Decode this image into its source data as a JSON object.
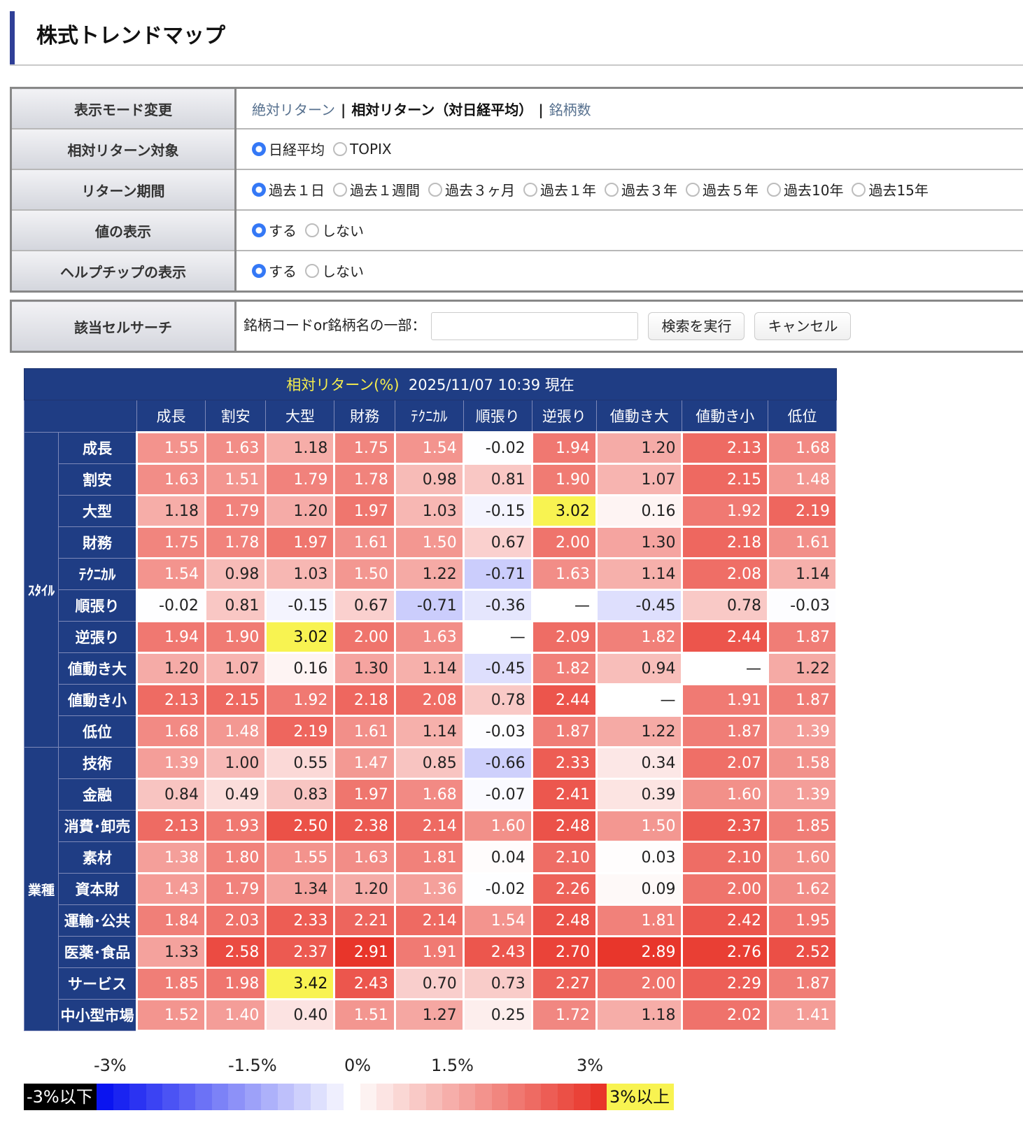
{
  "page": {
    "title": "株式トレンドマップ"
  },
  "settings": {
    "mode": {
      "label": "表示モード変更",
      "absolute": "絶対リターン",
      "relative": "相対リターン（対日経平均）",
      "count": "銘柄数"
    },
    "target": {
      "label": "相対リターン対象",
      "options": [
        "日経平均",
        "TOPIX"
      ],
      "selected": 0
    },
    "period": {
      "label": "リターン期間",
      "options": [
        "過去１日",
        "過去１週間",
        "過去３ヶ月",
        "過去１年",
        "過去３年",
        "過去５年",
        "過去10年",
        "過去15年"
      ],
      "selected": 0
    },
    "values": {
      "label": "値の表示",
      "options": [
        "する",
        "しない"
      ],
      "selected": 0
    },
    "tooltip": {
      "label": "ヘルプチップの表示",
      "options": [
        "する",
        "しない"
      ],
      "selected": 0
    }
  },
  "search": {
    "label": "該当セルサーチ",
    "prompt": "銘柄コードor銘柄名の一部：",
    "value": "",
    "run": "検索を実行",
    "cancel": "キャンセル"
  },
  "heatmap": {
    "caption_metric": "相対リターン(%)",
    "caption_time": "2025/11/07 10:39 現在",
    "columns": [
      "成長",
      "割安",
      "大型",
      "財務",
      "ﾃｸﾆｶﾙ",
      "順張り",
      "逆張り",
      "値動き大",
      "値動き小",
      "低位"
    ],
    "groups": [
      {
        "name": "ｽﾀｲﾙ",
        "rows": [
          {
            "label": "成長",
            "values": [
              "1.55",
              "1.63",
              "1.18",
              "1.75",
              "1.54",
              "-0.02",
              "1.94",
              "1.20",
              "2.13",
              "1.68"
            ]
          },
          {
            "label": "割安",
            "values": [
              "1.63",
              "1.51",
              "1.79",
              "1.78",
              "0.98",
              "0.81",
              "1.90",
              "1.07",
              "2.15",
              "1.48"
            ]
          },
          {
            "label": "大型",
            "values": [
              "1.18",
              "1.79",
              "1.20",
              "1.97",
              "1.03",
              "-0.15",
              "3.02",
              "0.16",
              "1.92",
              "2.19"
            ]
          },
          {
            "label": "財務",
            "values": [
              "1.75",
              "1.78",
              "1.97",
              "1.61",
              "1.50",
              "0.67",
              "2.00",
              "1.30",
              "2.18",
              "1.61"
            ]
          },
          {
            "label": "ﾃｸﾆｶﾙ",
            "values": [
              "1.54",
              "0.98",
              "1.03",
              "1.50",
              "1.22",
              "-0.71",
              "1.63",
              "1.14",
              "2.08",
              "1.14"
            ]
          },
          {
            "label": "順張り",
            "values": [
              "-0.02",
              "0.81",
              "-0.15",
              "0.67",
              "-0.71",
              "-0.36",
              "—",
              "-0.45",
              "0.78",
              "-0.03"
            ]
          },
          {
            "label": "逆張り",
            "values": [
              "1.94",
              "1.90",
              "3.02",
              "2.00",
              "1.63",
              "—",
              "2.09",
              "1.82",
              "2.44",
              "1.87"
            ]
          },
          {
            "label": "値動き大",
            "values": [
              "1.20",
              "1.07",
              "0.16",
              "1.30",
              "1.14",
              "-0.45",
              "1.82",
              "0.94",
              "—",
              "1.22"
            ]
          },
          {
            "label": "値動き小",
            "values": [
              "2.13",
              "2.15",
              "1.92",
              "2.18",
              "2.08",
              "0.78",
              "2.44",
              "—",
              "1.91",
              "1.87"
            ]
          },
          {
            "label": "低位",
            "values": [
              "1.68",
              "1.48",
              "2.19",
              "1.61",
              "1.14",
              "-0.03",
              "1.87",
              "1.22",
              "1.87",
              "1.39"
            ]
          }
        ]
      },
      {
        "name": "業種",
        "rows": [
          {
            "label": "技術",
            "values": [
              "1.39",
              "1.00",
              "0.55",
              "1.47",
              "0.85",
              "-0.66",
              "2.33",
              "0.34",
              "2.07",
              "1.58"
            ]
          },
          {
            "label": "金融",
            "values": [
              "0.84",
              "0.49",
              "0.83",
              "1.97",
              "1.68",
              "-0.07",
              "2.41",
              "0.39",
              "1.60",
              "1.39"
            ]
          },
          {
            "label": "消費･卸売",
            "values": [
              "2.13",
              "1.93",
              "2.50",
              "2.38",
              "2.14",
              "1.60",
              "2.48",
              "1.50",
              "2.37",
              "1.85"
            ]
          },
          {
            "label": "素材",
            "values": [
              "1.38",
              "1.80",
              "1.55",
              "1.63",
              "1.81",
              "0.04",
              "2.10",
              "0.03",
              "2.10",
              "1.60"
            ]
          },
          {
            "label": "資本財",
            "values": [
              "1.43",
              "1.79",
              "1.34",
              "1.20",
              "1.36",
              "-0.02",
              "2.26",
              "0.09",
              "2.00",
              "1.62"
            ]
          },
          {
            "label": "運輸･公共",
            "values": [
              "1.84",
              "2.03",
              "2.33",
              "2.21",
              "2.14",
              "1.54",
              "2.48",
              "1.81",
              "2.42",
              "1.95"
            ]
          },
          {
            "label": "医薬･食品",
            "values": [
              "1.33",
              "2.58",
              "2.37",
              "2.91",
              "1.91",
              "2.43",
              "2.70",
              "2.89",
              "2.76",
              "2.52"
            ]
          },
          {
            "label": "サービス",
            "values": [
              "1.85",
              "1.98",
              "3.42",
              "2.43",
              "0.70",
              "0.73",
              "2.27",
              "2.00",
              "2.29",
              "1.87"
            ]
          },
          {
            "label": "中小型市場",
            "values": [
              "1.52",
              "1.40",
              "0.40",
              "1.51",
              "1.27",
              "0.25",
              "1.72",
              "1.18",
              "2.02",
              "1.41"
            ]
          }
        ]
      }
    ]
  },
  "legend": {
    "ticks": [
      "-3%",
      "-1.5%",
      "0%",
      "1.5%",
      "3%"
    ],
    "low_label": "-3%以下",
    "high_label": "3%以上",
    "colors": {
      "negative_max": "#0a14f0",
      "zero": "#ffffff",
      "positive_max": "#e8352a",
      "over_threshold": "#f8f351",
      "under_threshold": "#000000"
    }
  }
}
